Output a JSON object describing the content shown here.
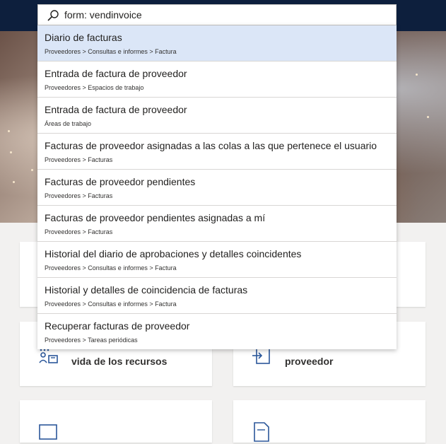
{
  "search": {
    "value": "form: vendinvoice"
  },
  "results": [
    {
      "title": "Diario de facturas",
      "path": "Proveedores > Consultas e informes > Factura"
    },
    {
      "title": "Entrada de factura de proveedor",
      "path": "Proveedores > Espacios de trabajo"
    },
    {
      "title": "Entrada de factura de proveedor",
      "path": "Áreas de trabajo"
    },
    {
      "title": "Facturas de proveedor asignadas a las colas a las que pertenece el usuario",
      "path": "Proveedores > Facturas"
    },
    {
      "title": "Facturas de proveedor pendientes",
      "path": "Proveedores > Facturas"
    },
    {
      "title": "Facturas de proveedor pendientes asignadas a mí",
      "path": "Proveedores > Facturas"
    },
    {
      "title": "Historial del diario de aprobaciones y detalles coincidentes",
      "path": "Proveedores > Consultas e informes > Factura"
    },
    {
      "title": "Historial y detalles de coincidencia de facturas",
      "path": "Proveedores > Consultas e informes > Factura"
    },
    {
      "title": "Recuperar facturas de proveedor",
      "path": "Proveedores > Tareas periódicas"
    }
  ],
  "tiles": {
    "resources_label": "vida de los recursos",
    "vendor_label": "proveedor"
  },
  "colors": {
    "topbar": "#0d1f3d",
    "selected_row": "#dbe6f7",
    "tile_icon": "#2b579a"
  },
  "icons": {
    "search": "search-icon",
    "resources_tile": "team-resources-icon",
    "vendor_tile": "document-arrow-icon"
  }
}
